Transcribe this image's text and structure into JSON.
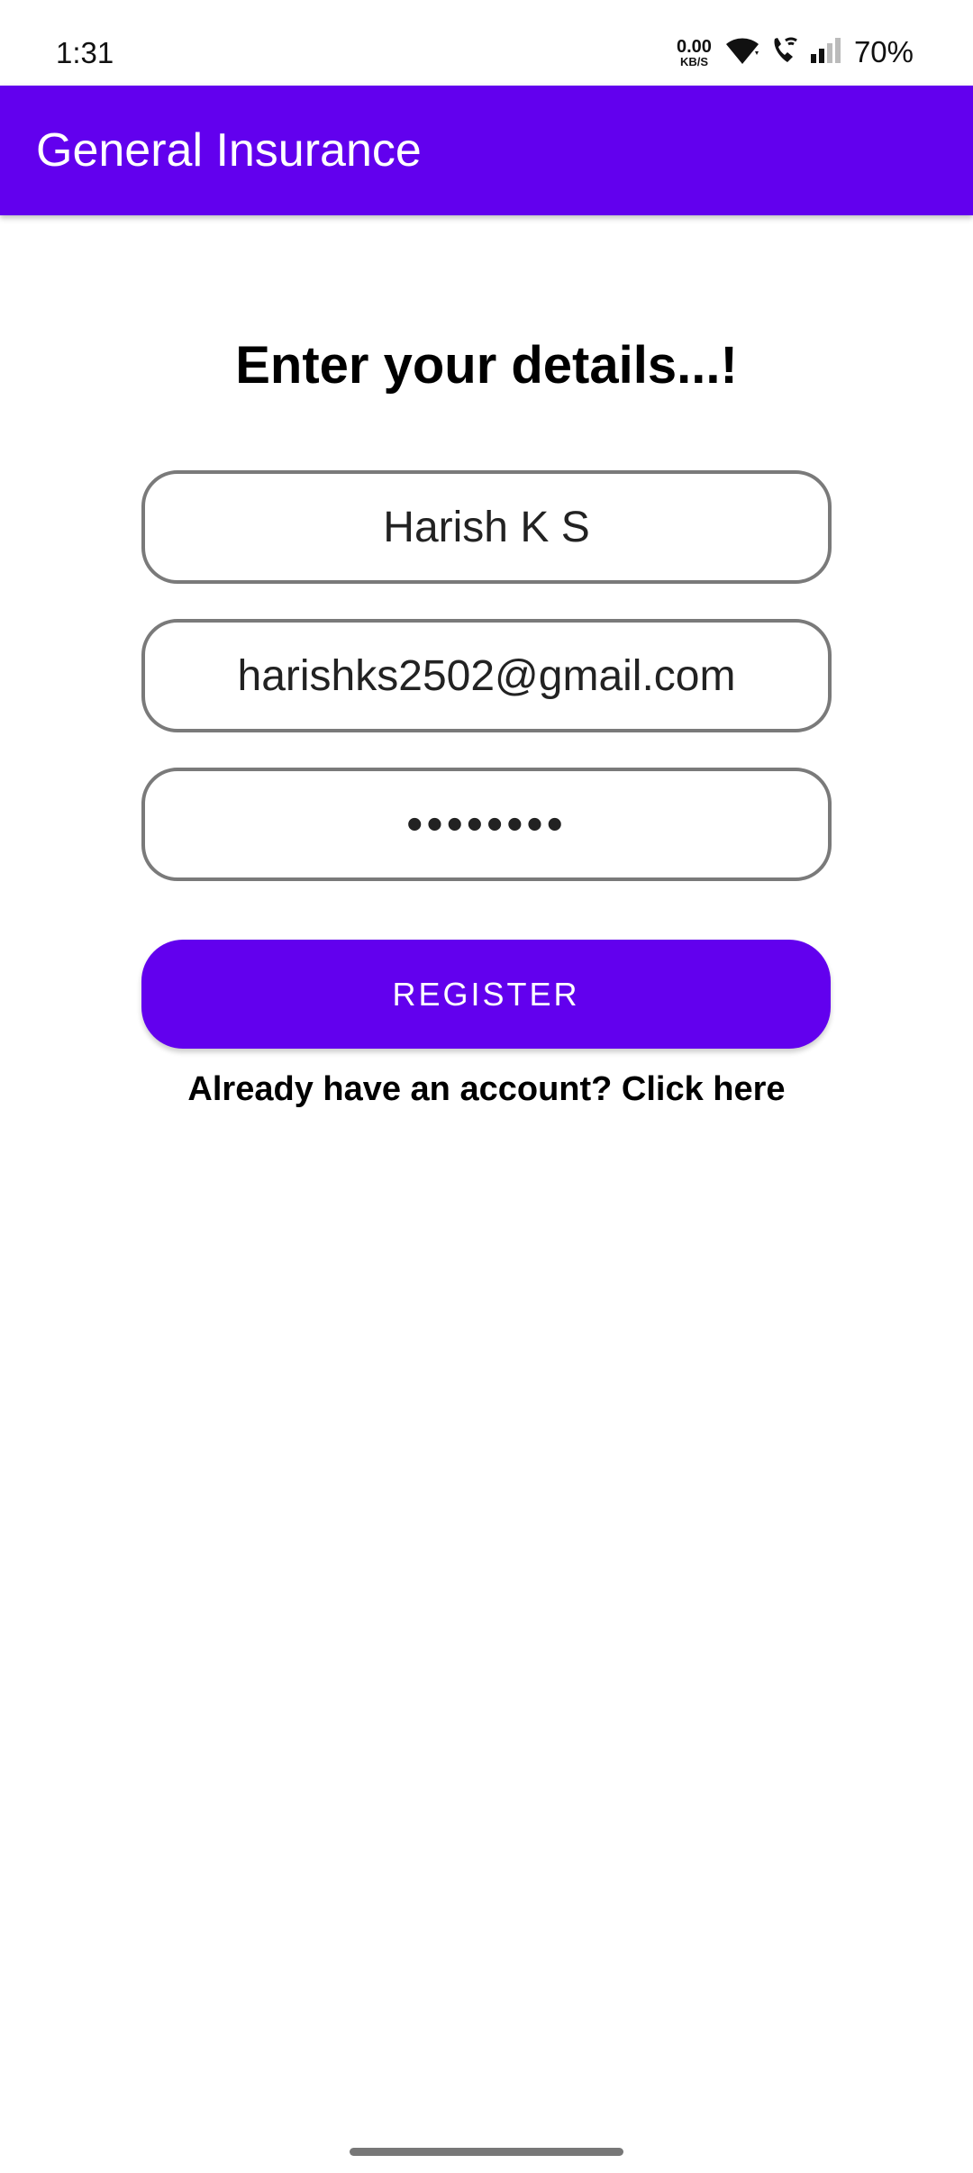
{
  "status_bar": {
    "time": "1:31",
    "net_speed_value": "0.00",
    "net_speed_unit": "KB/S",
    "battery": "70%"
  },
  "app_bar": {
    "title": "General Insurance",
    "color": "#6200EE"
  },
  "form": {
    "heading": "Enter your details...!",
    "name_value": "Harish K S",
    "email_value": "harishks2502@gmail.com",
    "password_value": "••••••••",
    "register_label": "REGISTER",
    "login_link": "Already have an account? Click here"
  },
  "icons": [
    "wifi-icon",
    "wifi-call-icon",
    "signal-icon"
  ]
}
